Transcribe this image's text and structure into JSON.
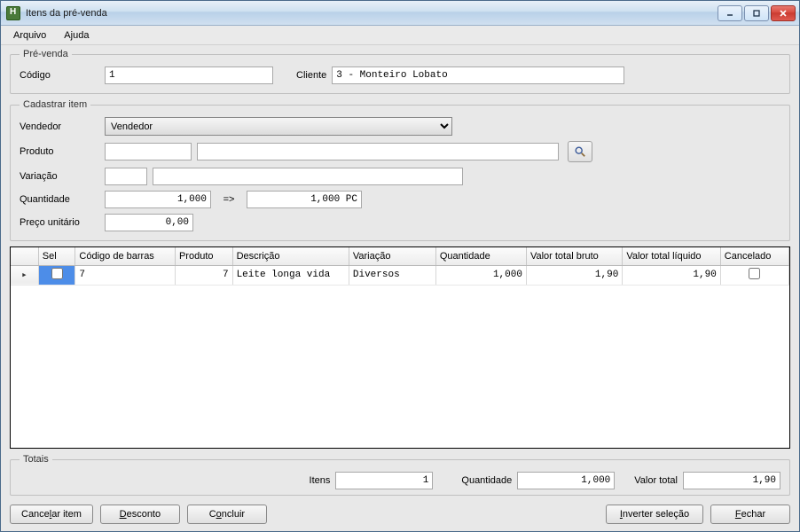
{
  "window": {
    "title": "Itens da pré-venda"
  },
  "menu": {
    "arquivo": "Arquivo",
    "ajuda": "Ajuda"
  },
  "prevenda": {
    "legend": "Pré-venda",
    "codigo_label": "Código",
    "codigo": "1",
    "cliente_label": "Cliente",
    "cliente": "3 - Monteiro Lobato"
  },
  "cadastrar": {
    "legend": "Cadastrar item",
    "vendedor_label": "Vendedor",
    "vendedor_value": "Vendedor",
    "produto_label": "Produto",
    "produto_code": "",
    "produto_name": "",
    "variacao_label": "Variação",
    "variacao_code": "",
    "variacao_name": "",
    "quantidade_label": "Quantidade",
    "quantidade": "1,000",
    "quantidade_arrow": "=>",
    "quantidade_converted": "1,000 PC",
    "preco_label": "Preço unitário",
    "preco": "0,00"
  },
  "grid": {
    "headers": {
      "sel": "Sel",
      "codigo_barras": "Código de barras",
      "produto": "Produto",
      "descricao": "Descrição",
      "variacao": "Variação",
      "quantidade": "Quantidade",
      "valor_bruto": "Valor total bruto",
      "valor_liquido": "Valor total líquido",
      "cancelado": "Cancelado"
    },
    "rows": [
      {
        "codigo_barras": "7",
        "produto": "7",
        "descricao": "Leite longa vida",
        "variacao": "Diversos",
        "quantidade": "1,000",
        "valor_bruto": "1,90",
        "valor_liquido": "1,90"
      }
    ]
  },
  "totals": {
    "legend": "Totais",
    "itens_label": "Itens",
    "itens": "1",
    "quantidade_label": "Quantidade",
    "quantidade": "1,000",
    "valor_total_label": "Valor total",
    "valor_total": "1,90"
  },
  "buttons": {
    "cancelar_item": "Cancelar item",
    "desconto": "Desconto",
    "concluir": "Concluir",
    "inverter": "Inverter seleção",
    "fechar": "Fechar"
  }
}
